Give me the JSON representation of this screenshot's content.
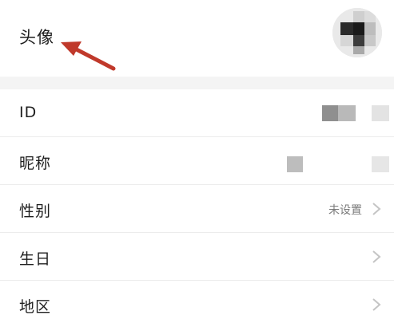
{
  "avatar": {
    "label": "头像",
    "icon": "avatar-pixelated"
  },
  "rows": [
    {
      "label": "ID",
      "value": ""
    },
    {
      "label": "昵称",
      "value": ""
    },
    {
      "label": "性别",
      "value": "未设置"
    },
    {
      "label": "生日",
      "value": ""
    },
    {
      "label": "地区",
      "value": ""
    }
  ],
  "colors": {
    "arrow": "#c0392b",
    "label_text": "#1f1f1f",
    "value_text": "#7a7a7a",
    "chevron": "#c4c4c4",
    "separator_band": "#f4f4f4"
  }
}
